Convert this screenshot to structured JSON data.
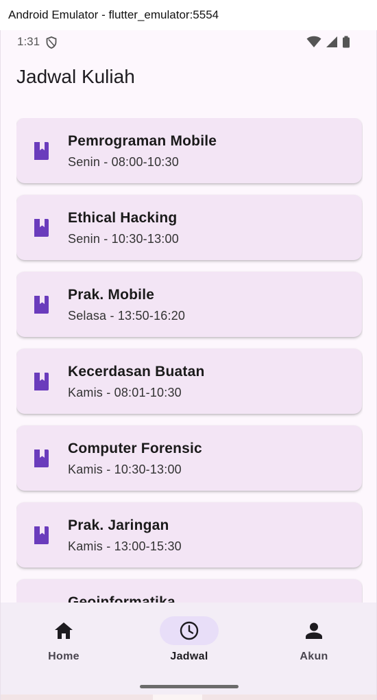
{
  "window": {
    "title": "Android Emulator - flutter_emulator:5554"
  },
  "status_bar": {
    "time": "1:31"
  },
  "app_bar": {
    "title": "Jadwal Kuliah"
  },
  "schedule": [
    {
      "course": "Pemrograman Mobile",
      "when": "Senin - 08:00-10:30",
      "icon": "book-icon"
    },
    {
      "course": "Ethical Hacking",
      "when": "Senin - 10:30-13:00",
      "icon": "book-icon"
    },
    {
      "course": "Prak. Mobile",
      "when": "Selasa - 13:50-16:20",
      "icon": "book-icon"
    },
    {
      "course": "Kecerdasan Buatan",
      "when": "Kamis - 08:01-10:30",
      "icon": "book-icon"
    },
    {
      "course": "Computer Forensic",
      "when": "Kamis - 10:30-13:00",
      "icon": "book-icon"
    },
    {
      "course": "Prak. Jaringan",
      "when": "Kamis - 13:00-15:30",
      "icon": "book-icon"
    },
    {
      "course": "Geoinformatika",
      "when": "",
      "icon": "book-icon"
    }
  ],
  "bottom_nav": {
    "items": [
      {
        "label": "Home",
        "icon": "home-icon",
        "active": false
      },
      {
        "label": "Jadwal",
        "icon": "clock-icon",
        "active": true
      },
      {
        "label": "Akun",
        "icon": "person-icon",
        "active": false
      }
    ]
  },
  "colors": {
    "accent": "#6a3cbc",
    "card_bg": "#f3e5f5",
    "nav_bg": "#f3edf6",
    "nav_active_pill": "#e8def8"
  }
}
